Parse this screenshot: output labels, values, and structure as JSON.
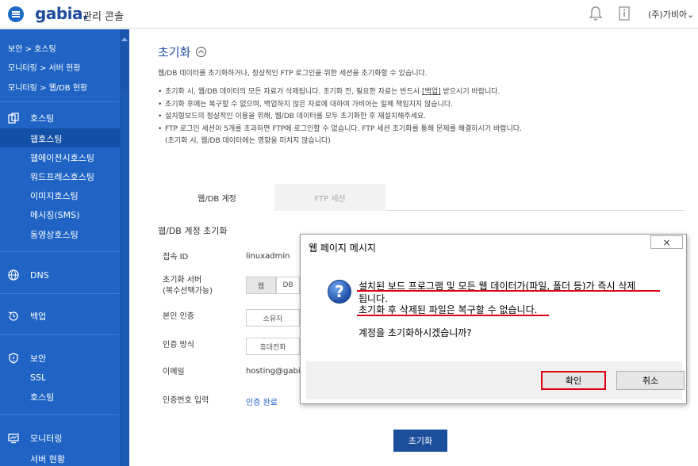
{
  "header": {
    "logo": "gabia.",
    "logo_sub": "관리 콘솔",
    "company": "(주)가비아"
  },
  "sidebar": {
    "top_items": [
      "보안 > 호스팅",
      "모니터링 > 서버 현황",
      "모니터링 > 웹/DB 현황"
    ],
    "hosting": {
      "label": "호스팅",
      "items": [
        "웹호스팅",
        "웹에이전시호스팅",
        "워드프레스호스팅",
        "이미지호스팅",
        "메시징(SMS)",
        "동영상호스팅"
      ]
    },
    "dns": "DNS",
    "backup": "백업",
    "security": {
      "label": "보안",
      "items": [
        "SSL",
        "호스팅"
      ]
    },
    "monitoring": {
      "label": "모니터링",
      "items": [
        "서버 현황"
      ]
    }
  },
  "main": {
    "title": "초기화",
    "description": "웹/DB 데이터를 초기화하거나, 정상적인 FTP 로그인을 위한 세션을 초기화할 수 있습니다.",
    "notes": [
      "초기화 시, 웹/DB 데이터의 모든 자료가 삭제됩니다. 초기화 전, 필요한 자료는 반드시",
      "초기화 후에는 복구할 수 없으며, 백업하지 않은 자료에 대하여 가비아는 일체 책임지지 않습니다.",
      "설치형보드의 정상적인 이용을 위해, 웹/DB 데이터를 모두 초기화한 후 재설치해주세요.",
      "FTP 로그인 세션이 5개를 초과하면 FTP에 로그인할 수 없습니다. FTP 세션 초기화를 통해 문제를 해결하시기 바랍니다.",
      "(초기화 시, 웹/DB 데이터에는 영향을 미치지 않습니다)"
    ],
    "backup_link": "[백업]",
    "backup_suffix": " 받으시기 바랍니다.",
    "tabs": [
      "웹/DB 계정",
      "FTP 세션"
    ],
    "section_title": "웹/DB 계정 초기화",
    "form": {
      "id_label": "접속 ID",
      "id_value": "linuxadmin",
      "server_label": "초기화 서버",
      "server_label_sub": "(복수선택가능)",
      "server_opt1": "웹",
      "server_opt2": "DB",
      "auth_label": "본인 인증",
      "auth_opt": "소유자",
      "method_label": "인증 방식",
      "method_opt": "휴대전화",
      "email_label": "이메일",
      "email_value": "hosting@gabia",
      "code_label": "인증번호 입력",
      "code_value": "인증 완료"
    },
    "reset_button": "초기화"
  },
  "dialog": {
    "title": "웹 페이지 메시지",
    "line1": "설치된 보드 프로그램 및 모든 웹 데이터가(파일, 폴더 등)가 즉시 삭제",
    "line2": "됩니다.",
    "line3": "초기화 후 삭제된 파일은 복구할 수 없습니다.",
    "line4": "계정을 초기화하시겠습니까?",
    "ok": "확인",
    "cancel": "취소",
    "close": "×"
  }
}
